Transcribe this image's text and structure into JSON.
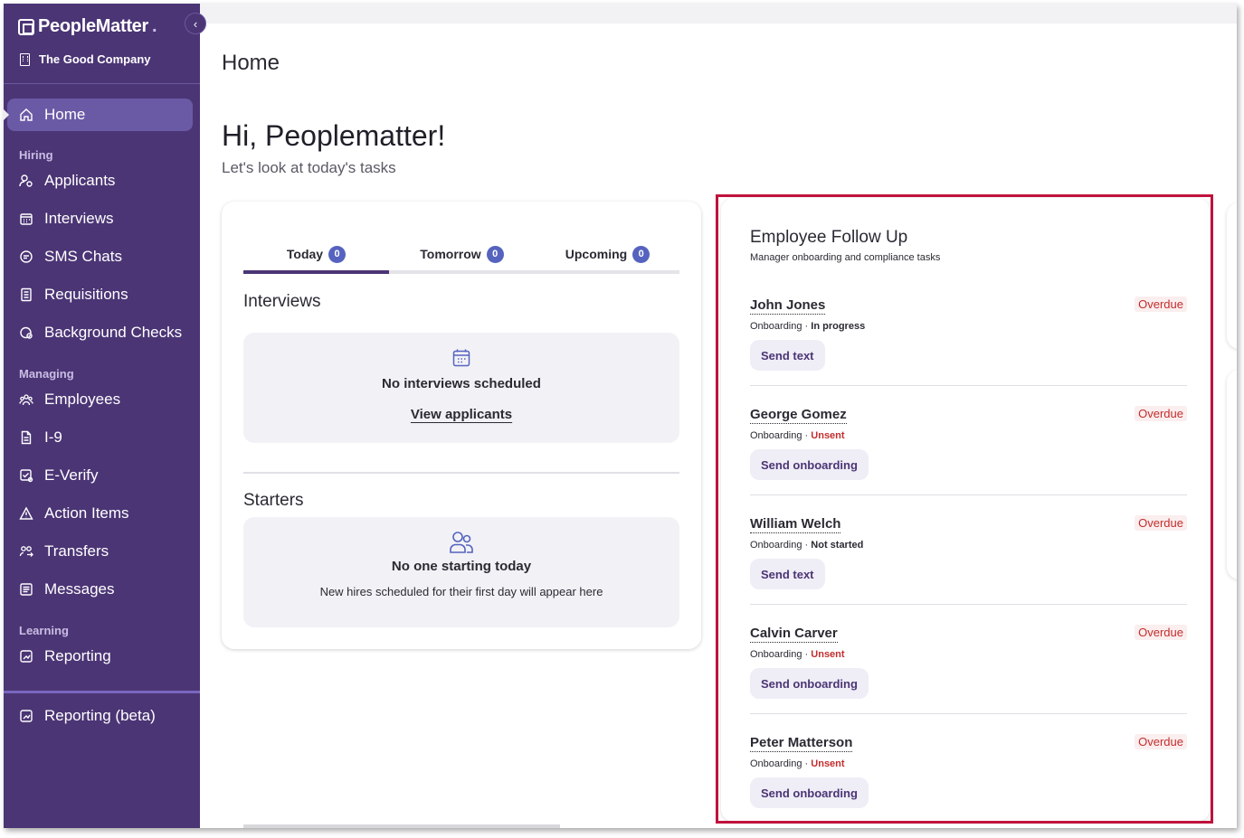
{
  "app": {
    "brand_name": "PeopleMatter",
    "brand_dot": ".",
    "company": "The Good Company"
  },
  "sidebar": {
    "home": "Home",
    "sections": [
      {
        "label": "Hiring",
        "items": [
          "Applicants",
          "Interviews",
          "SMS Chats",
          "Requisitions",
          "Background Checks"
        ]
      },
      {
        "label": "Managing",
        "items": [
          "Employees",
          "I-9",
          "E-Verify",
          "Action Items",
          "Transfers",
          "Messages"
        ]
      },
      {
        "label": "Learning",
        "items": [
          "Reporting"
        ]
      }
    ],
    "bottom_item": "Reporting (beta)"
  },
  "header": {
    "title": "Home",
    "greeting": "Hi, Peoplematter!",
    "subtitle": "Let's look at today's tasks"
  },
  "tasks": {
    "tabs": [
      {
        "label": "Today",
        "count": "0"
      },
      {
        "label": "Tomorrow",
        "count": "0"
      },
      {
        "label": "Upcoming",
        "count": "0"
      }
    ],
    "interviews": {
      "title": "Interviews",
      "empty_title": "No interviews scheduled",
      "link": "View applicants"
    },
    "starters": {
      "title": "Starters",
      "empty_title": "No one starting today",
      "empty_text": "New hires scheduled for their first day will appear here"
    }
  },
  "follow_up": {
    "title": "Employee Follow Up",
    "subtitle": "Manager onboarding and compliance tasks",
    "rows": [
      {
        "name": "John Jones",
        "badge": "Overdue",
        "type": "Onboarding",
        "status": "In progress",
        "action": "Send text"
      },
      {
        "name": "George Gomez",
        "badge": "Overdue",
        "type": "Onboarding",
        "status": "Unsent",
        "action": "Send onboarding"
      },
      {
        "name": "William Welch",
        "badge": "Overdue",
        "type": "Onboarding",
        "status": "Not started",
        "action": "Send text"
      },
      {
        "name": "Calvin Carver",
        "badge": "Overdue",
        "type": "Onboarding",
        "status": "Unsent",
        "action": "Send onboarding"
      },
      {
        "name": "Peter Matterson",
        "badge": "Overdue",
        "type": "Onboarding",
        "status": "Unsent",
        "action": "Send onboarding"
      }
    ]
  },
  "colors": {
    "sidebar": "#4b3575",
    "accent": "#5563bf",
    "overdue": "#c42d2d",
    "highlight": "#c0123c"
  }
}
